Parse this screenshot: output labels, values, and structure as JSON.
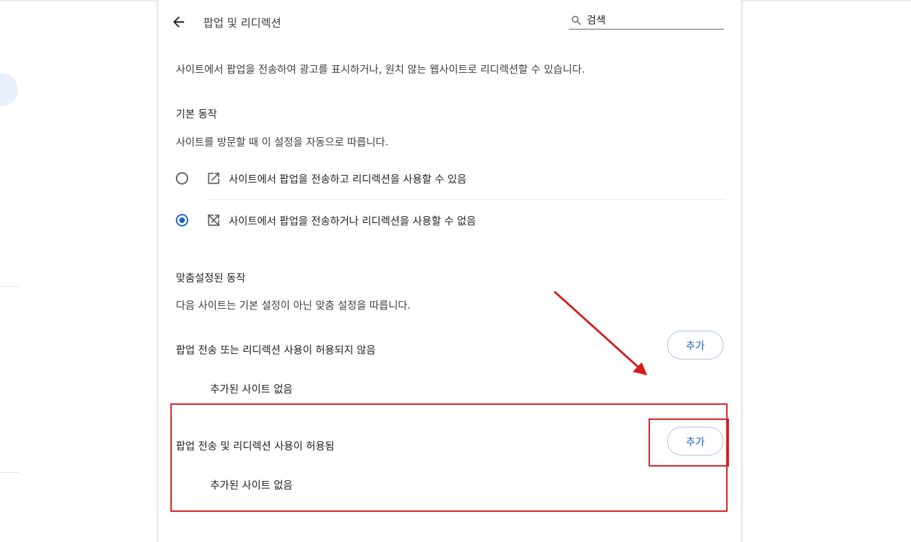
{
  "header": {
    "title": "팝업 및 리디렉션",
    "back_icon": "arrow-back-icon",
    "search": {
      "icon": "search-icon",
      "value": "",
      "placeholder": "검색"
    }
  },
  "description": "사이트에서 팝업을 전송하여 광고를 표시하거나, 원치 않는 웹사이트로 리디렉션할 수 있습니다.",
  "default_behavior": {
    "heading": "기본 동작",
    "subtext": "사이트를 방문할 때 이 설정을 자동으로 따릅니다.",
    "options": [
      {
        "label": "사이트에서 팝업을 전송하고 리디렉션을 사용할 수 있음",
        "icon": "open-in-new-icon",
        "selected": false
      },
      {
        "label": "사이트에서 팝업을 전송하거나 리디렉션을 사용할 수 없음",
        "icon": "open-in-new-off-icon",
        "selected": true
      }
    ]
  },
  "custom_behavior": {
    "heading": "맞춤설정된 동작",
    "subtext": "다음 사이트는 기본 설정이 아닌 맞춤 설정을 따릅니다.",
    "sections": [
      {
        "title": "팝업 전송 또는 리디렉션 사용이 허용되지 않음",
        "add_label": "추가",
        "empty_text": "추가된 사이트 없음"
      },
      {
        "title": "팝업 전송 및 리디렉션 사용이 허용됨",
        "add_label": "추가",
        "empty_text": "추가된 사이트 없음"
      }
    ]
  },
  "colors": {
    "accent": "#1a62cc",
    "annotation": "#d41d1d"
  }
}
